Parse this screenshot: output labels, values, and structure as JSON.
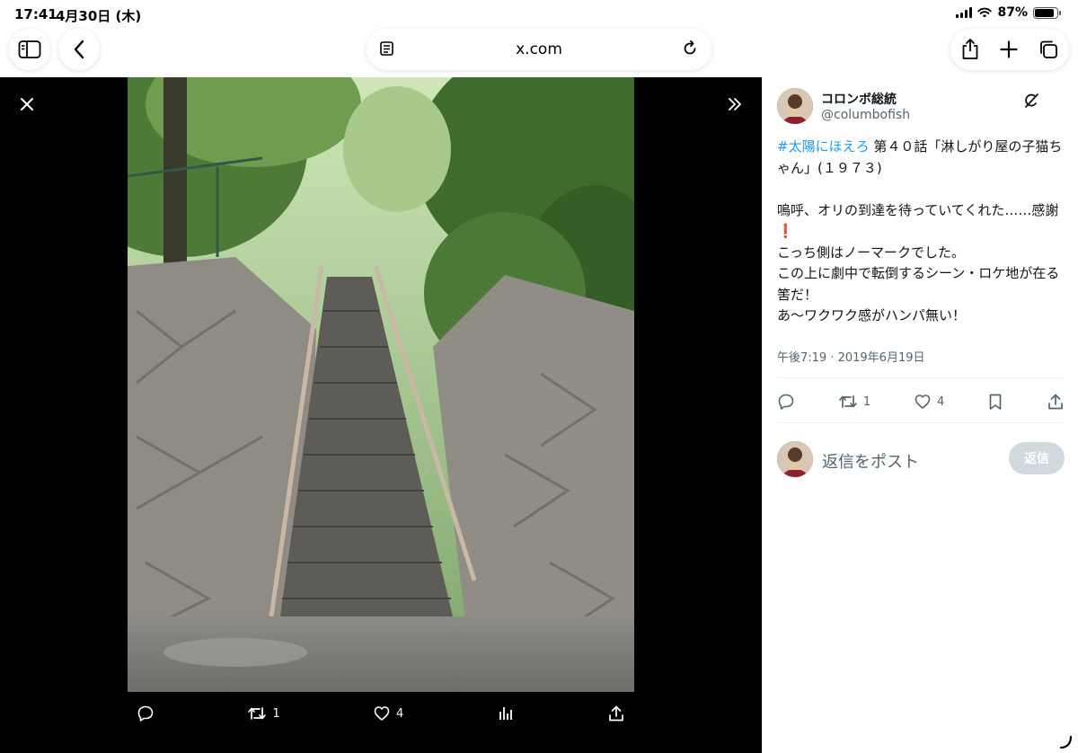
{
  "status": {
    "time": "17:41",
    "date": "4月30日 (木)",
    "battery_pct": "87%",
    "battery_level": 0.87
  },
  "browser": {
    "url": "x.com",
    "icons": [
      "sidebar-icon",
      "back-icon",
      "reader-icon",
      "reload-icon",
      "share-icon",
      "new-tab-icon",
      "tabs-icon"
    ]
  },
  "viewer": {
    "actions": {
      "retweet_count": "1",
      "like_count": "4"
    }
  },
  "tweet": {
    "author_name": "コロンボ総統",
    "author_handle": "@columbofish",
    "hashtag": "#太陽にほえろ",
    "line1_rest": " 第４０話「淋しがり屋の子猫ちゃん」(１９７３)",
    "line2": "嗚呼、オリの到達を待っていてくれた……感謝",
    "emoji": "❗",
    "line3": "こっち側はノーマークでした。",
    "line4": "この上に劇中で転倒するシーン・ロケ地が在る筈だ！",
    "line5": "あ〜ワクワク感がハンパ無い！",
    "timestamp": "午後7:19 · 2019年6月19日",
    "retweet_count": "1",
    "like_count": "4"
  },
  "reply": {
    "placeholder": "返信をポスト",
    "button_label": "返信"
  },
  "colors": {
    "accent": "#1d9bf0",
    "muted": "#536471",
    "divider": "#eff3f4",
    "reply_button_disabled": "#cfd9de"
  }
}
